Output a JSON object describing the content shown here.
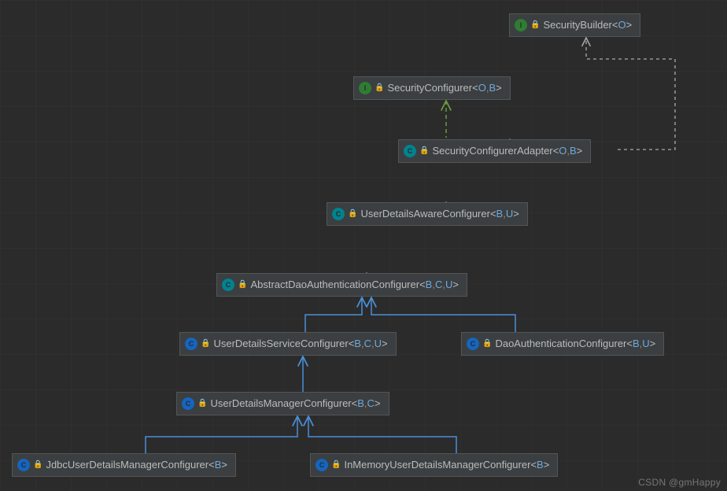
{
  "watermark": "CSDN @gmHappy",
  "diagram": {
    "type": "uml-class-hierarchy",
    "nodes": {
      "securityBuilder": {
        "kind": "interface",
        "name": "SecurityBuilder",
        "typeParams": [
          "O"
        ]
      },
      "securityConfigurer": {
        "kind": "interface",
        "name": "SecurityConfigurer",
        "typeParams": [
          "O",
          "B"
        ]
      },
      "securityConfigurerAdapter": {
        "kind": "abstract",
        "name": "SecurityConfigurerAdapter",
        "typeParams": [
          "O",
          "B"
        ]
      },
      "userDetailsAwareConfigurer": {
        "kind": "abstract",
        "name": "UserDetailsAwareConfigurer",
        "typeParams": [
          "B",
          "U"
        ]
      },
      "abstractDaoAuthenticationConfigurer": {
        "kind": "abstract",
        "name": "AbstractDaoAuthenticationConfigurer",
        "typeParams": [
          "B",
          "C",
          "U"
        ]
      },
      "userDetailsServiceConfigurer": {
        "kind": "class",
        "name": "UserDetailsServiceConfigurer",
        "typeParams": [
          "B",
          "C",
          "U"
        ]
      },
      "daoAuthenticationConfigurer": {
        "kind": "class",
        "name": "DaoAuthenticationConfigurer",
        "typeParams": [
          "B",
          "U"
        ]
      },
      "userDetailsManagerConfigurer": {
        "kind": "class",
        "name": "UserDetailsManagerConfigurer",
        "typeParams": [
          "B",
          "C"
        ]
      },
      "jdbcUserDetailsManagerConfigurer": {
        "kind": "class",
        "name": "JdbcUserDetailsManagerConfigurer",
        "typeParams": [
          "B"
        ]
      },
      "inMemoryUserDetailsManagerConfigurer": {
        "kind": "class",
        "name": "InMemoryUserDetailsManagerConfigurer",
        "typeParams": [
          "B"
        ]
      }
    },
    "typeKindBadge": {
      "interface": "I",
      "class": "C",
      "abstract": "C"
    },
    "lockGlyph": "🔒",
    "edges": [
      {
        "from": "securityConfigurerAdapter",
        "to": "securityConfigurer",
        "style": "implements"
      },
      {
        "from": "securityConfigurerAdapter",
        "to": "securityBuilder",
        "style": "uses"
      },
      {
        "from": "userDetailsAwareConfigurer",
        "to": "securityConfigurerAdapter",
        "style": "extends"
      },
      {
        "from": "abstractDaoAuthenticationConfigurer",
        "to": "userDetailsAwareConfigurer",
        "style": "extends"
      },
      {
        "from": "userDetailsServiceConfigurer",
        "to": "abstractDaoAuthenticationConfigurer",
        "style": "extends"
      },
      {
        "from": "daoAuthenticationConfigurer",
        "to": "abstractDaoAuthenticationConfigurer",
        "style": "extends"
      },
      {
        "from": "userDetailsManagerConfigurer",
        "to": "userDetailsServiceConfigurer",
        "style": "extends"
      },
      {
        "from": "jdbcUserDetailsManagerConfigurer",
        "to": "userDetailsManagerConfigurer",
        "style": "extends"
      },
      {
        "from": "inMemoryUserDetailsManagerConfigurer",
        "to": "userDetailsManagerConfigurer",
        "style": "extends"
      }
    ],
    "edgeStyle": {
      "implements": {
        "stroke": "#6a9940",
        "dash": "5,4",
        "arrow": "open"
      },
      "extends": {
        "stroke": "#4a90d9",
        "dash": "",
        "arrow": "open"
      },
      "uses": {
        "stroke": "#aaaaaa",
        "dash": "4,4",
        "arrow": "open"
      }
    }
  },
  "colors": {
    "gridBg": "#2b2b2b",
    "nodeBg": "#3b3f41",
    "nodeBorder": "#555555",
    "typeParam": "#6fa8dc",
    "comma": "#cc7832"
  }
}
